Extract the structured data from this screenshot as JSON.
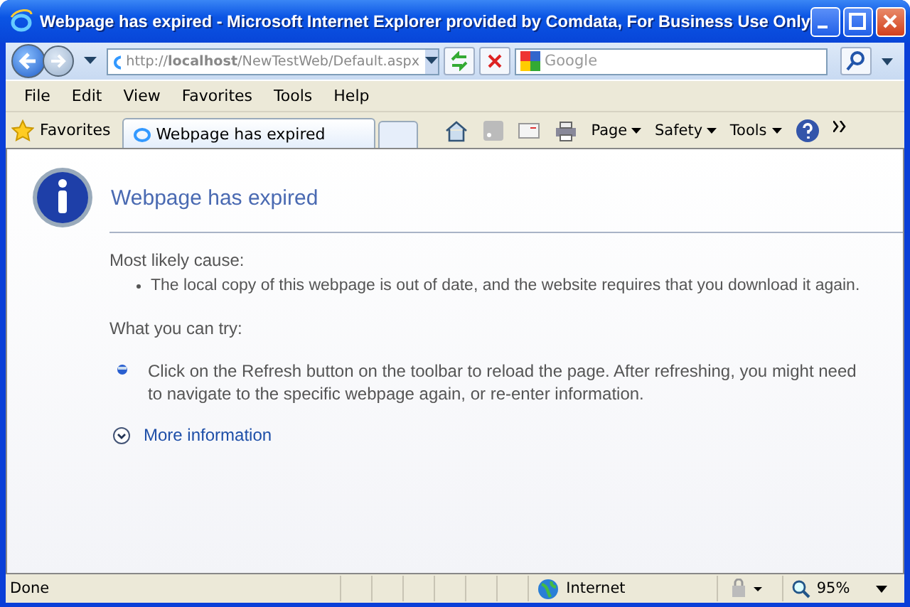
{
  "window": {
    "title": "Webpage has expired - Microsoft Internet Explorer provided by Comdata, For Business Use Only"
  },
  "address_bar": {
    "url": "http://**localhost**/NewTestWeb/Default.aspx"
  },
  "search": {
    "placeholder": "Google"
  },
  "menu": [
    "File",
    "Edit",
    "View",
    "Favorites",
    "Tools",
    "Help"
  ],
  "favorites_button": "Favorites",
  "tabs": [
    {
      "label": "Webpage has expired",
      "selected": true
    }
  ],
  "command_bar": [
    "Page",
    "Safety",
    "Tools"
  ],
  "page": {
    "heading": "Webpage has expired",
    "cause_title": "Most likely cause:",
    "cause_items": [
      "The local copy of this webpage is out of date, and the website requires that you download it again."
    ],
    "try_title": "What you can try:",
    "try_items": [
      "Click on the Refresh button on the toolbar to reload the page. After refreshing, you might need to navigate to the specific webpage again, or re-enter information."
    ],
    "more_link": "More information"
  },
  "status_bar": {
    "text": "Done",
    "zone": "Internet",
    "zoom": "95%"
  }
}
